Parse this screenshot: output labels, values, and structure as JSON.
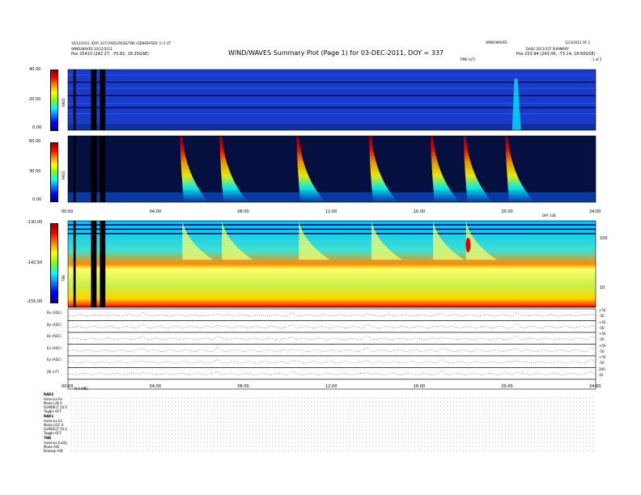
{
  "header": {
    "line1_left": "10/12/2011 (DOY 337) RAD1/RAD2/TNR (GENERATED: 1) 5 UT",
    "line2_left": "WIND/WAVES 10/12/2011",
    "line3_left": "Pos  25410 (242.27, -70.82, 18.25GSE)",
    "title": "WIND/WAVES Summary Plot (Page 1) for 03-DEC-2011, DOY = 337",
    "line1_right_a": "WIND/WAVES",
    "line1_right_b": "12/3/2011 OF 2",
    "line2_right": "DAILY 2011/337 SUMMARY",
    "line3_right": "Pos  233.94 (243.06, -73.14, 18.60GSE)",
    "tmark": "TIME (UT)",
    "tmark_right": "1 of 2"
  },
  "colorbar_colors": [
    "#8b0000",
    "#ff0000",
    "#ff8c00",
    "#ffff00",
    "#7fff00",
    "#00ffff",
    "#0080ff",
    "#0000ff",
    "#00008b"
  ],
  "panels": {
    "rad2": {
      "label": "RAD2",
      "ticks": [
        "40.00",
        "20.00",
        "0.00"
      ]
    },
    "rad1": {
      "label": "RAD1",
      "ticks": [
        "60.00",
        "30.00",
        "0.00"
      ]
    },
    "tnr": {
      "label": "TNR",
      "ticks": [
        "-130.00",
        "-142.50",
        "-155.00"
      ],
      "right_ticks": [
        "100",
        "10"
      ]
    }
  },
  "time_ticks": [
    "00:00",
    "04:00",
    "08:00",
    "12:00",
    "16:00",
    "20:00",
    "24:00"
  ],
  "time_ticks_lower": [
    "00:00",
    "04:00",
    "08:00",
    "12:00",
    "16:00",
    "20:00",
    "24:00"
  ],
  "time_axis_right_label": "DAY 338",
  "line_panels": [
    {
      "label": "Bx (ADC)",
      "right_ticks": [
        "+50",
        "-50"
      ]
    },
    {
      "label": "By (ADC)",
      "right_ticks": [
        "+50",
        "-50"
      ]
    },
    {
      "label": "Bz (ADC)",
      "right_ticks": [
        "+50",
        "-50"
      ]
    },
    {
      "label": "Ex (ADC)",
      "right_ticks": [
        "+50",
        "-50"
      ]
    },
    {
      "label": "Ey (ADC)",
      "right_ticks": [
        "+50",
        "-50"
      ]
    },
    {
      "label": "|B| (nT)",
      "right_ticks": [
        "200",
        "10"
      ]
    }
  ],
  "status_block": {
    "rad2_title": "RAD2",
    "rad2_rows": [
      "Antenna   Ex",
      "Mode   LIN  X",
      "SUMDELT 10.0",
      "Toggle   OFF"
    ],
    "rad1_title": "RAD1",
    "rad1_rows": [
      "Antenna   Ex",
      "Mode   LOG  X",
      "SUMDELT 10.0",
      "Toggle   OFF"
    ],
    "tnr_title": "TNR",
    "tnr_rows": [
      "Antenna   Ex/Ey",
      "Mode   A/B",
      "Bsweep   A/B"
    ]
  },
  "marker_row": "N  A  MBC"
}
